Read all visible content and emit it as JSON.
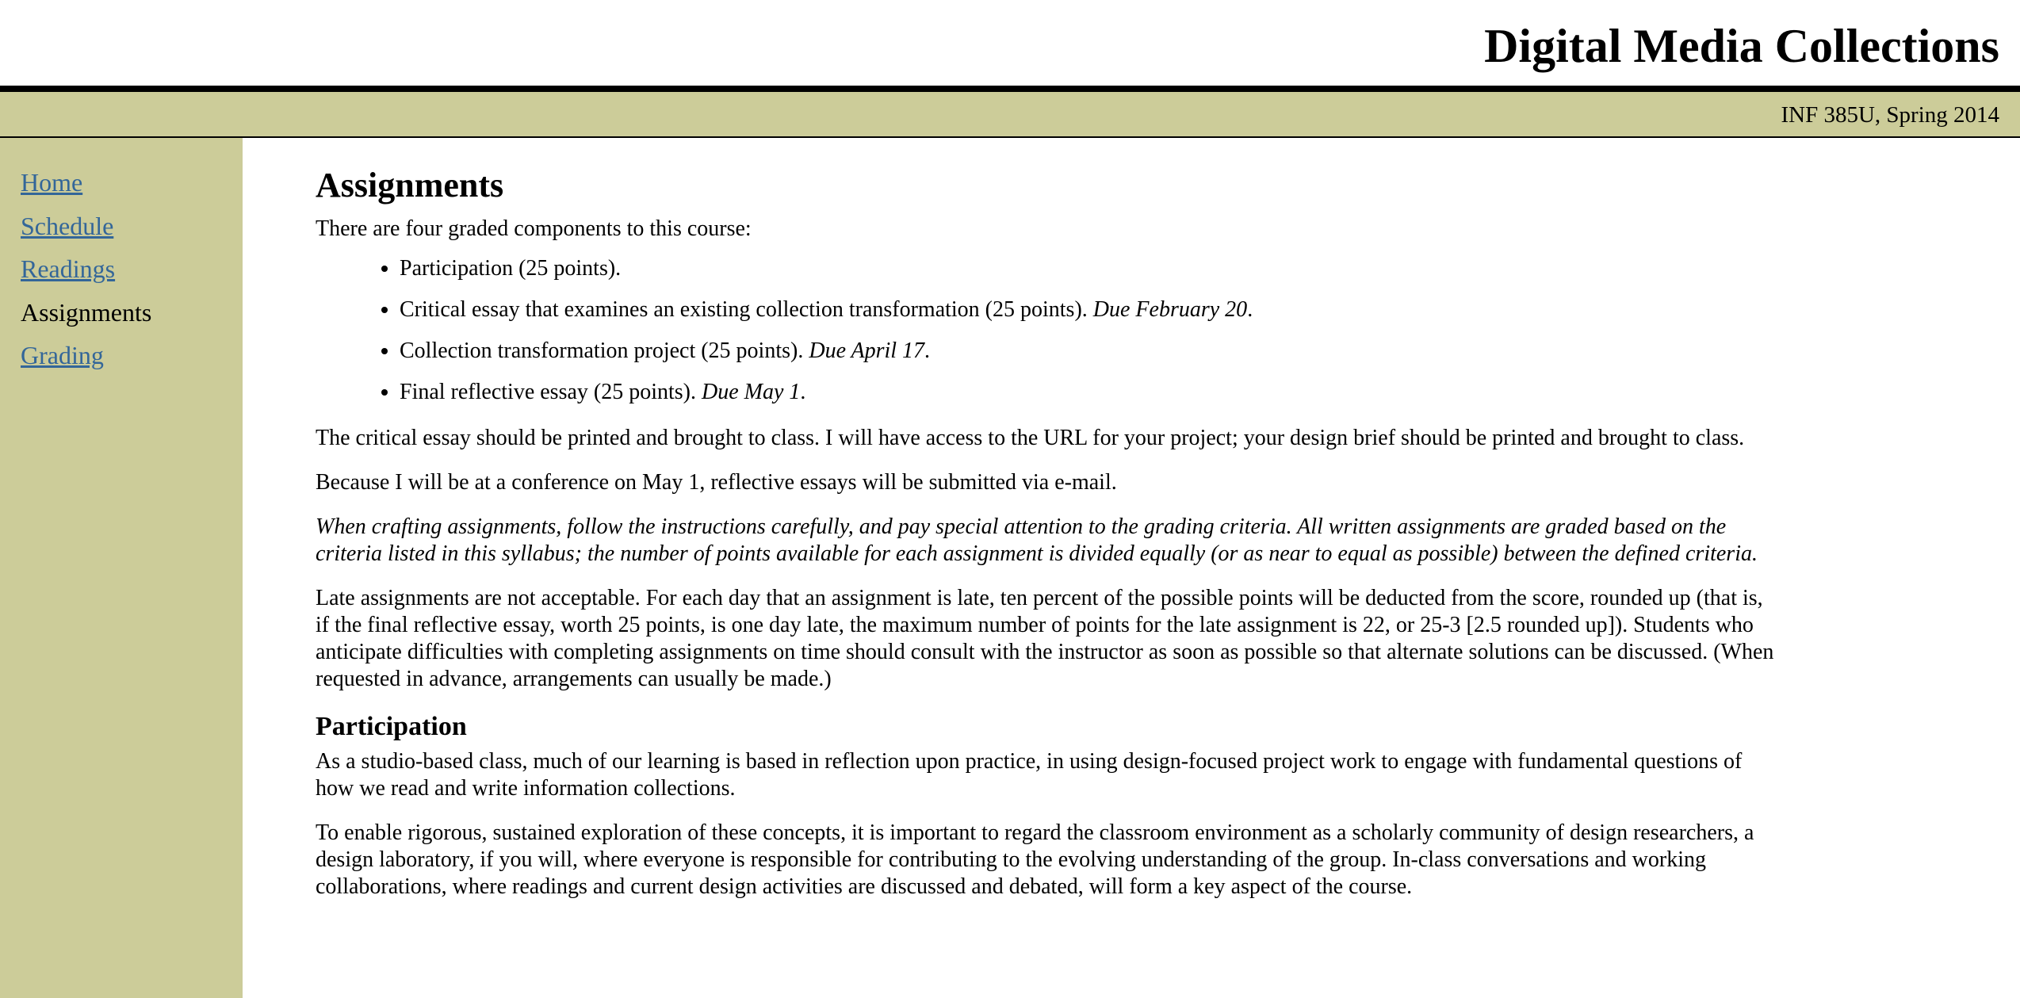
{
  "header": {
    "site_title": "Digital Media Collections",
    "course": "INF 385U, Spring 2014"
  },
  "sidebar": {
    "items": [
      {
        "label": "Home",
        "current": false
      },
      {
        "label": "Schedule",
        "current": false
      },
      {
        "label": "Readings",
        "current": false
      },
      {
        "label": "Assignments",
        "current": true
      },
      {
        "label": "Grading",
        "current": false
      }
    ]
  },
  "main": {
    "title": "Assignments",
    "intro": "There are four graded components to this course:",
    "components": [
      {
        "text": "Participation (25 points).",
        "due": "",
        "after": ""
      },
      {
        "text": "Critical essay that examines an existing collection transformation (25 points). ",
        "due": "Due February 20",
        "after": "."
      },
      {
        "text": "Collection transformation project (25 points). ",
        "due": "Due April 17",
        "after": "."
      },
      {
        "text": "Final reflective essay (25 points). ",
        "due": "Due May 1",
        "after": "."
      }
    ],
    "para_submission": "The critical essay should be printed and brought to class. I will have access to the URL for your project; your design brief should be printed and brought to class.",
    "para_conference": "Because I will be at a conference on May 1, reflective essays will be submitted via e-mail.",
    "para_criteria": "When crafting assignments, follow the instructions carefully, and pay special attention to the grading criteria. All written assignments are graded based on the criteria listed in this syllabus; the number of points available for each assignment is divided equally (or as near to equal as possible) between the defined criteria.",
    "para_late": "Late assignments are not acceptable. For each day that an assignment is late, ten percent of the possible points will be deducted from the score, rounded up (that is, if the final reflective essay, worth 25 points, is one day late, the maximum number of points for the late assignment is 22, or 25-3 [2.5 rounded up]). Students who anticipate difficulties with completing assignments on time should consult with the instructor as soon as possible so that alternate solutions can be discussed. (When requested in advance, arrangements can usually be made.)",
    "participation_heading": "Participation",
    "para_participation_1": "As a studio-based class, much of our learning is based in reflection upon practice, in using design-focused project work to engage with fundamental questions of how we read and write information collections.",
    "para_participation_2": "To enable rigorous, sustained exploration of these concepts, it is important to regard the classroom environment as a scholarly community of design researchers, a design laboratory, if you will, where everyone is responsible for contributing to the evolving understanding of the group. In-class conversations and working collaborations, where readings and current design activities are discussed and debated, will form a key aspect of the course."
  },
  "colors": {
    "band": "#cccc99",
    "link": "#336699",
    "rule": "#000000"
  }
}
